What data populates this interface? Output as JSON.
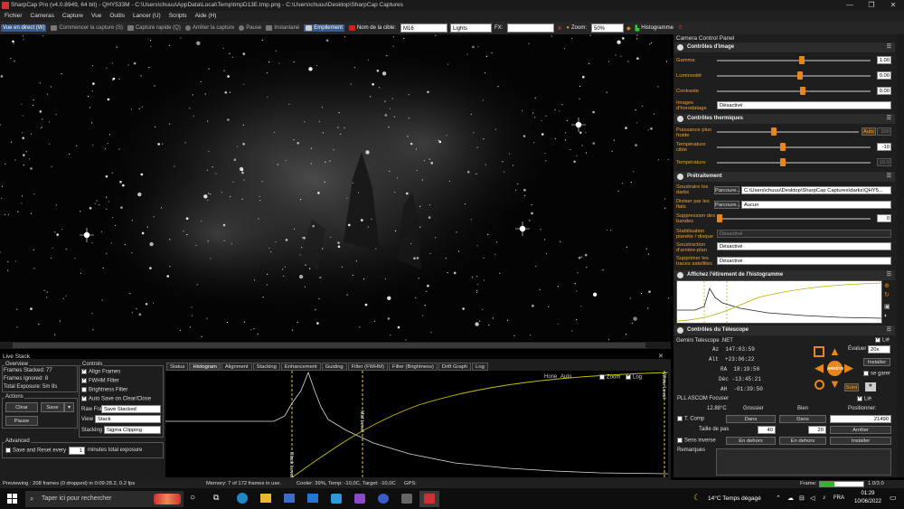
{
  "window": {
    "title": "SharpCap Pro (v4.0.8949, 64 bit) - QHY533M - C:\\Users\\chuuu\\AppData\\Local\\Temp\\tmpD13E.tmp.png - C:\\Users\\chuuu\\Desktop\\SharpCap Captures",
    "minimize": "—",
    "maximize": "❐",
    "close": "✕"
  },
  "menu": [
    "Fichier",
    "Cameras",
    "Capture",
    "Vue",
    "Outils",
    "Lancer (U)",
    "Scripts",
    "Aide (H)"
  ],
  "toolbar": {
    "live_view": "Vue en direct (W)",
    "start_capture": "Commencer la capture (S)",
    "quick_capture": "Capture rapide (Q)",
    "stop_capture": "Arrêter la capture",
    "pause": "Pause",
    "snapshot": "Instantané",
    "stacking": "Empilement",
    "target_label": "Nom de la cible:",
    "target_value": "M16",
    "frame_type": "Lights",
    "fx_label": "FX:",
    "fx_value": "",
    "zoom_label": "Zoom:",
    "zoom_value": "50%",
    "histogram": "Histogramme"
  },
  "ccp": {
    "title": "Camera Control Panel",
    "image_controls": {
      "title": "Contrôles d'image",
      "gamma_label": "Gamma",
      "gamma_value": "1.00",
      "gamma_level": 0.55,
      "brightness_label": "Luminosité",
      "brightness_value": "0.00",
      "brightness_level": 0.54,
      "contrast_label": "Contraste",
      "contrast_value": "0.00",
      "contrast_level": 0.56,
      "timestamp_label": "Images d'horodatage",
      "timestamp_value": "Désactivé"
    },
    "thermal_controls": {
      "title": "Contrôles thermiques",
      "cooler_label": "Puissance plus froide",
      "cooler_auto": "Auto",
      "cooler_value": "100",
      "cooler_level": 0.4,
      "target_temp_label": "Température cible",
      "target_temp_value": "-10",
      "target_temp_level": 0.43,
      "temperature_label": "Température",
      "temperature_value": "10.0",
      "temperature_level": 0.43
    },
    "preprocessing": {
      "title": "Prétraitement",
      "darks_label": "Soustraire les darks",
      "darks_button": "Parcoure...",
      "darks_value": "C:\\Users\\chuuu\\Desktop\\SharpCap Captures\\darks\\QHY5...",
      "flats_label": "Diviser par les flats",
      "flats_button": "Parcoure...",
      "flats_value": "Aucun",
      "banding_label": "Suppression des bandes",
      "banding_value": "0",
      "stabilization_label": "Stabilisation planète / disque",
      "stabilization_value": "Désactivé",
      "background_label": "Soustraction d'arrière-plan",
      "background_value": "Désactivé",
      "satellite_label": "Supprimer les traces satellites",
      "satellite_value": "Désactivé"
    },
    "histogram": {
      "title": "Affichez l'étirement de l'histogramme"
    },
    "telescope": {
      "title": "Contrôles du Télescope",
      "driver": "Gemini Telescope .NET",
      "linked": "Lié",
      "az_label": "Az",
      "az_value": "147:03:59",
      "alt_label": "Alt",
      "alt_value": "+23:06:22",
      "ra_label": "RA",
      "ra_value": "18:19:50",
      "dec_label": "Déc",
      "dec_value": "-13:45:21",
      "ah_label": "AH",
      "ah_value": "-01:39:50",
      "speed_label": "Évaluer",
      "speed_value": "20x",
      "install": "Installer",
      "park": "se garer",
      "follow": "Suivi",
      "center": "ARRÊTE"
    },
    "focuser": {
      "title": "PLL ASCOM Focuser",
      "linked": "Lié",
      "temp": "12.88°C",
      "coarse": "Grossier",
      "fine": "Bien",
      "position_label": "Positionner:",
      "tcomp": "T. Comp",
      "in1": "Dans",
      "in2": "Dans",
      "position_value": "21490",
      "step_label": "Taille de pas",
      "step1": "40",
      "step2": "20",
      "stop": "Arrêter",
      "reverse": "Sens inverse",
      "out1": "En dehors",
      "out2": "En dehors",
      "install": "Installer",
      "remarks": "Remarques"
    }
  },
  "live_stack": {
    "title": "Live Stack",
    "overview_title": "Overview",
    "frames_stacked_label": "Frames Stacked:",
    "frames_stacked": "77",
    "frames_ignored_label": "Frames Ignored:",
    "frames_ignored": "8",
    "total_exposure_label": "Total Exposure:",
    "total_exposure": "5m 8s",
    "controls_title": "Controls",
    "align": "Align Frames",
    "fwhm": "FWHM Filter",
    "brightness": "Brightness Filter",
    "autosave": "Auto Save on Clear/Close",
    "raw_frames_label": "Raw Frames",
    "raw_frames_value": "Save Stacked",
    "view_label": "View",
    "view_value": "Stack",
    "stacking_label": "Stacking",
    "stacking_value": "Sigma Clipping",
    "actions_title": "Actions",
    "clear": "Clear",
    "save": "Save",
    "pause": "Pause",
    "advanced_title": "Advanced",
    "save_reset": "Save and Reset every",
    "save_reset_value": "1",
    "minutes_total": "minutes total exposure",
    "tabs": [
      "Status",
      "Histogram",
      "Alignment",
      "Stacking",
      "Enhancement",
      "Guiding",
      "Filter (FWHM)",
      "Filter (Brightness)",
      "Drift Graph",
      "Log"
    ],
    "hone": "Hone",
    "auto": "Auto",
    "zoom": "Zoom",
    "log": "Log",
    "black_level": "Black Level",
    "white_level": "White Level",
    "mid_level": "Mid Level"
  },
  "statusbar": {
    "previewing": "Previewing : 208 frames (0 dropped) in 0:09:28.2, 0.2 fps",
    "memory": "Memory: 7 of 172 frames in use.",
    "cooler": "Cooler: 39%, Temp: -10,0C, Target: -10,0C",
    "gps": "GPS:",
    "frame_label": "Frame:",
    "frame_value": "1.0/3.0",
    "frame_progress": 0.33
  },
  "taskbar": {
    "search_placeholder": "Taper ici pour rechercher",
    "weather": "14°C  Temps dégagé",
    "lang": "FRA",
    "time": "01:29",
    "date": "10/06/2022"
  },
  "colors": {
    "accent": "#e8861a",
    "active_tool": "#3a5a8a",
    "panel": "#1e1e1e"
  }
}
